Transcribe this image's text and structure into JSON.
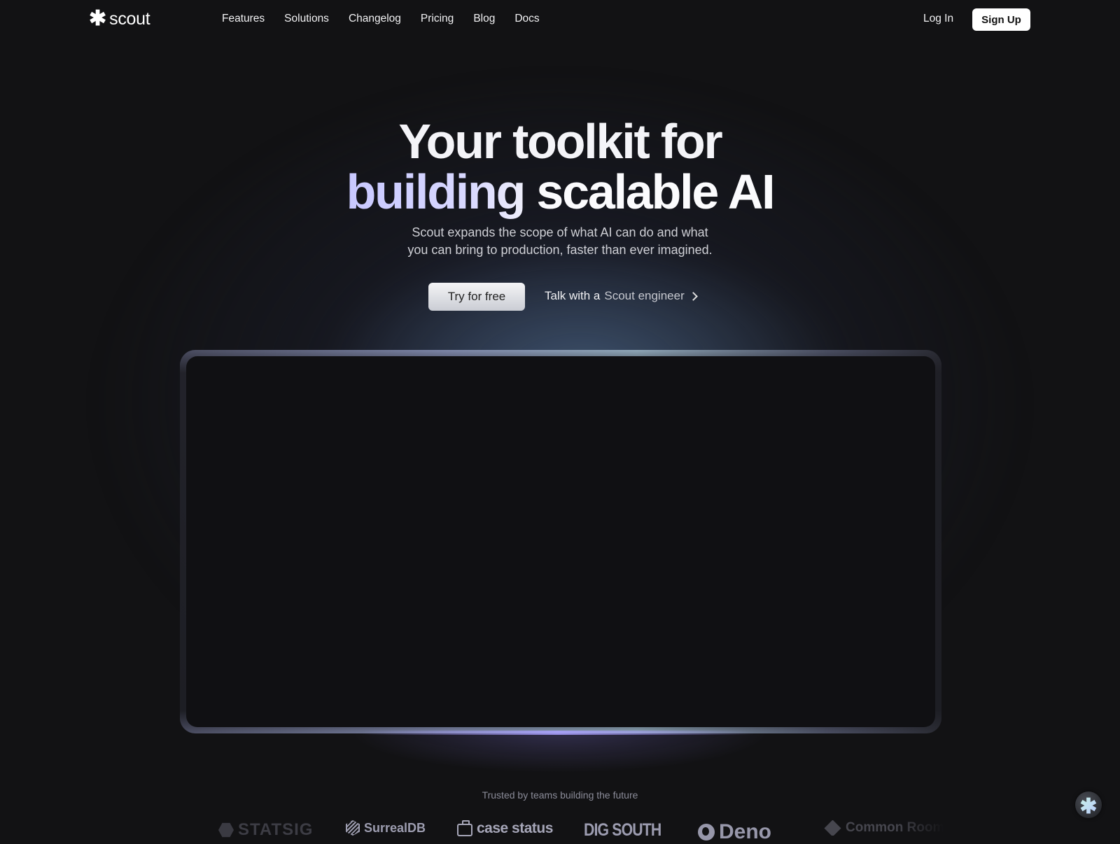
{
  "brand": {
    "logo_icon": "asterisk-icon",
    "logo_glyph": "✱",
    "name": "scout"
  },
  "nav": {
    "links": [
      {
        "label": "Features"
      },
      {
        "label": "Solutions"
      },
      {
        "label": "Changelog"
      },
      {
        "label": "Pricing"
      },
      {
        "label": "Blog"
      },
      {
        "label": "Docs"
      }
    ],
    "login_label": "Log In",
    "signup_label": "Sign Up"
  },
  "hero": {
    "title_line1": "Your toolkit for",
    "title_line2_accent": "building",
    "title_line2_rest": "scalable AI",
    "subtitle_line1": "Scout expands the scope of what AI can do and what",
    "subtitle_line2": "you can bring to production, faster than ever imagined.",
    "cta_primary": "Try for free",
    "cta_secondary_a": "Talk with a",
    "cta_secondary_b": "Scout engineer",
    "cta_secondary_icon": "chevron-right-icon"
  },
  "trusted": {
    "label": "Trusted by teams building the future",
    "logos": [
      {
        "name": "STATSIG",
        "icon": "statsig-hexagon-icon"
      },
      {
        "name": "SurrealDB",
        "icon": "surrealdb-cube-icon"
      },
      {
        "name": "case status",
        "icon": "briefcase-icon"
      },
      {
        "name": "DIG SOUTH",
        "icon": "lightning-icon"
      },
      {
        "name": "Deno",
        "icon": "deno-dinosaur-icon"
      },
      {
        "name": "Common Room",
        "icon": "diamond-icon"
      }
    ]
  },
  "chat_widget": {
    "icon": "asterisk-icon",
    "glyph": "✱"
  },
  "colors": {
    "background": "#121214",
    "accent_text": "#c8c8ff",
    "primary_button": "#e6e7ea",
    "signup_button": "#ffffff"
  }
}
